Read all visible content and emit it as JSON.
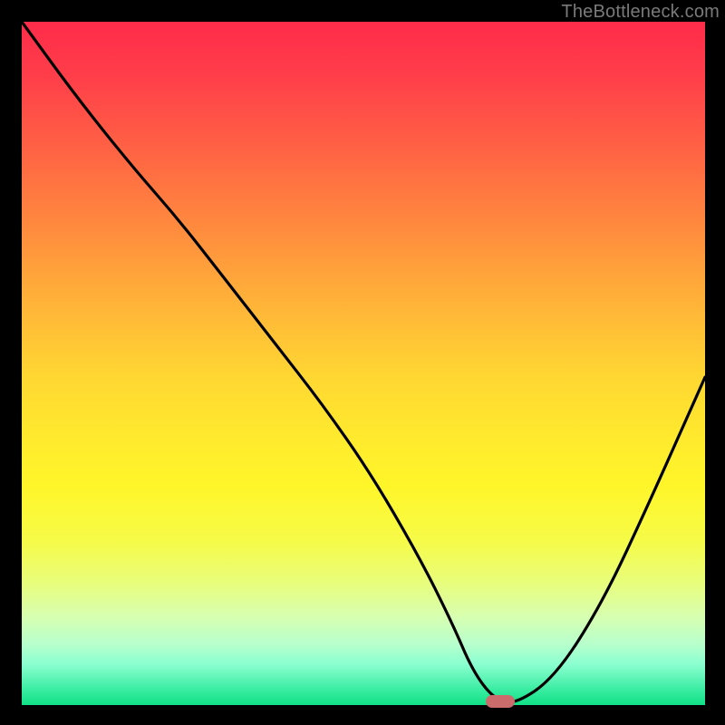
{
  "watermark": "TheBottleneck.com",
  "chart_data": {
    "type": "line",
    "title": "",
    "xlabel": "",
    "ylabel": "",
    "xlim": [
      0,
      100
    ],
    "ylim": [
      0,
      100
    ],
    "grid": false,
    "legend": false,
    "background_gradient": {
      "top": "#ff2b4a",
      "middle": "#ffe82e",
      "bottom": "#10e085"
    },
    "series": [
      {
        "name": "bottleneck-curve",
        "color": "#000000",
        "x": [
          0,
          8,
          16,
          23,
          30,
          37,
          44,
          51,
          58,
          63,
          66,
          69,
          72,
          78,
          85,
          92,
          100
        ],
        "y": [
          100,
          89,
          79,
          71,
          62,
          53,
          44,
          34,
          22,
          12,
          5,
          1,
          0,
          4,
          15,
          30,
          48
        ]
      }
    ],
    "marker": {
      "x": 70,
      "y": 0.5,
      "color": "#cc6b6b",
      "shape": "pill"
    }
  }
}
